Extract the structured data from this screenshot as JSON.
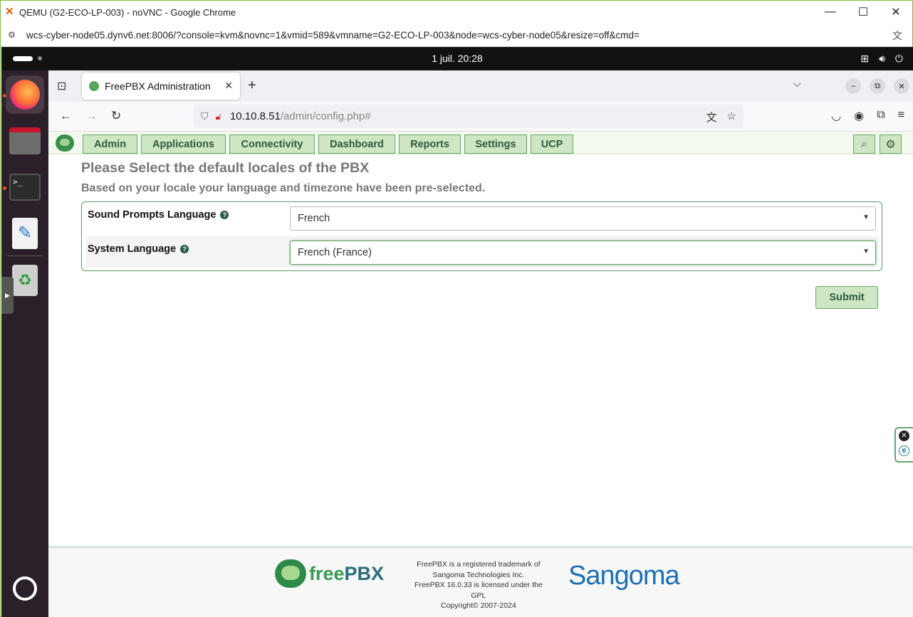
{
  "chrome": {
    "window_title": "QEMU (G2-ECO-LP-003) - noVNC - Google Chrome",
    "url": "wcs-cyber-node05.dynv6.net:8006/?console=kvm&novnc=1&vmid=589&vmname=G2-ECO-LP-003&node=wcs-cyber-node05&resize=off&cmd=",
    "minimize": "—",
    "maximize": "☐",
    "close": "✕"
  },
  "desktop": {
    "clock": "1 juil.  20:28"
  },
  "firefox": {
    "tab_title": "FreePBX Administration",
    "url_host": "10.10.8.51",
    "url_path": "/admin/config.php#"
  },
  "freepbx": {
    "menu": [
      "Admin",
      "Applications",
      "Connectivity",
      "Dashboard",
      "Reports",
      "Settings",
      "UCP"
    ],
    "heading": "Please Select the default locales of the PBX",
    "subheading": "Based on your locale your language and timezone have been pre-selected.",
    "fields": [
      {
        "label": "Sound Prompts Language",
        "value": "French"
      },
      {
        "label": "System Language",
        "value": "French (France)"
      }
    ],
    "submit": "Submit",
    "footer": {
      "brand_free": "free",
      "brand_pbx": "PBX",
      "legal_1": "FreePBX is a registered trademark of",
      "legal_2": "Sangoma Technologies Inc.",
      "legal_3": "FreePBX 16.0.33 is licensed under the",
      "legal_4": "GPL",
      "legal_5": "Copyright© 2007-2024",
      "sangoma": "Sangoma"
    }
  }
}
